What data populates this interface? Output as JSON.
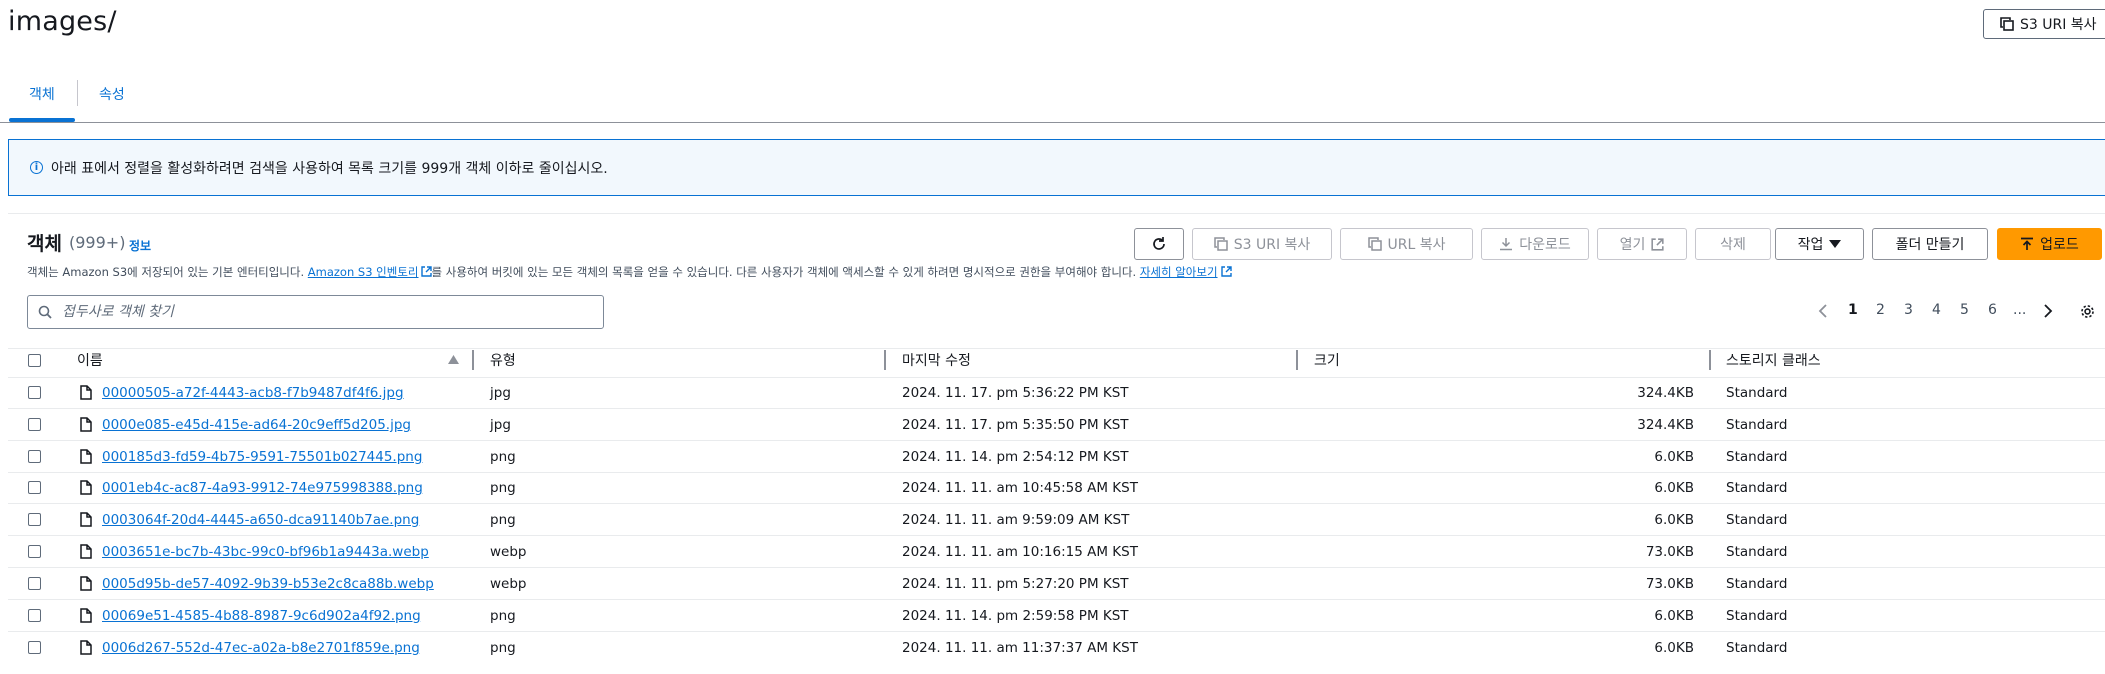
{
  "header": {
    "title": "images/",
    "copy_s3_uri": "S3 URI 복사"
  },
  "tabs": [
    {
      "label": "객체"
    },
    {
      "label": "속성"
    }
  ],
  "alert": {
    "text": "아래 표에서 정렬을 활성화하려면 검색을 사용하여 목록 크기를 999개 객체 이하로 줄이십시오."
  },
  "objects_panel": {
    "title": "객체",
    "count": "(999+)",
    "info": "정보",
    "desc_prefix": "객체는 Amazon S3에 저장되어 있는 기본 엔터티입니다.",
    "desc_link1": "Amazon S3 인벤토리",
    "desc_middle": "를 사용하여 버킷에 있는 모든 객체의 목록을 얻을 수 있습니다. 다른 사용자가 객체에 액세스할 수 있게 하려면 명시적으로 권한을 부여해야 합니다.",
    "desc_link2": "자세히 알아보기"
  },
  "toolbar": {
    "copy_s3_uri": "S3 URI 복사",
    "copy_url": "URL 복사",
    "download": "다운로드",
    "open": "열기",
    "delete": "삭제",
    "actions": "작업",
    "create_folder": "폴더 만들기",
    "upload": "업로드"
  },
  "search": {
    "placeholder": "접두사로 객체 찾기"
  },
  "pagination": {
    "pages": [
      "1",
      "2",
      "3",
      "4",
      "5",
      "6",
      "..."
    ],
    "current": "1"
  },
  "table": {
    "columns": {
      "name": "이름",
      "type": "유형",
      "modified": "마지막 수정",
      "size": "크기",
      "storage": "스토리지 클래스"
    },
    "rows": [
      {
        "name": "00000505-a72f-4443-acb8-f7b9487df4f6.jpg",
        "type": "jpg",
        "modified": "2024. 11. 17. pm 5:36:22 PM KST",
        "size": "324.4KB",
        "storage": "Standard"
      },
      {
        "name": "0000e085-e45d-415e-ad64-20c9eff5d205.jpg",
        "type": "jpg",
        "modified": "2024. 11. 17. pm 5:35:50 PM KST",
        "size": "324.4KB",
        "storage": "Standard"
      },
      {
        "name": "000185d3-fd59-4b75-9591-75501b027445.png",
        "type": "png",
        "modified": "2024. 11. 14. pm 2:54:12 PM KST",
        "size": "6.0KB",
        "storage": "Standard"
      },
      {
        "name": "0001eb4c-ac87-4a93-9912-74e975998388.png",
        "type": "png",
        "modified": "2024. 11. 11. am 10:45:58 AM KST",
        "size": "6.0KB",
        "storage": "Standard"
      },
      {
        "name": "0003064f-20d4-4445-a650-dca91140b7ae.png",
        "type": "png",
        "modified": "2024. 11. 11. am 9:59:09 AM KST",
        "size": "6.0KB",
        "storage": "Standard"
      },
      {
        "name": "0003651e-bc7b-43bc-99c0-bf96b1a9443a.webp",
        "type": "webp",
        "modified": "2024. 11. 11. am 10:16:15 AM KST",
        "size": "73.0KB",
        "storage": "Standard"
      },
      {
        "name": "0005d95b-de57-4092-9b39-b53e2c8ca88b.webp",
        "type": "webp",
        "modified": "2024. 11. 11. pm 5:27:20 PM KST",
        "size": "73.0KB",
        "storage": "Standard"
      },
      {
        "name": "00069e51-4585-4b88-8987-9c6d902a4f92.png",
        "type": "png",
        "modified": "2024. 11. 14. pm 2:59:58 PM KST",
        "size": "6.0KB",
        "storage": "Standard"
      },
      {
        "name": "0006d267-552d-47ec-a02a-b8e2701f859e.png",
        "type": "png",
        "modified": "2024. 11. 11. am 11:37:37 AM KST",
        "size": "6.0KB",
        "storage": "Standard"
      }
    ]
  },
  "colors": {
    "link": "#0972d3",
    "primary_button": "#ff9900",
    "alert_bg": "#f2f8fd",
    "text": "#16191f"
  }
}
